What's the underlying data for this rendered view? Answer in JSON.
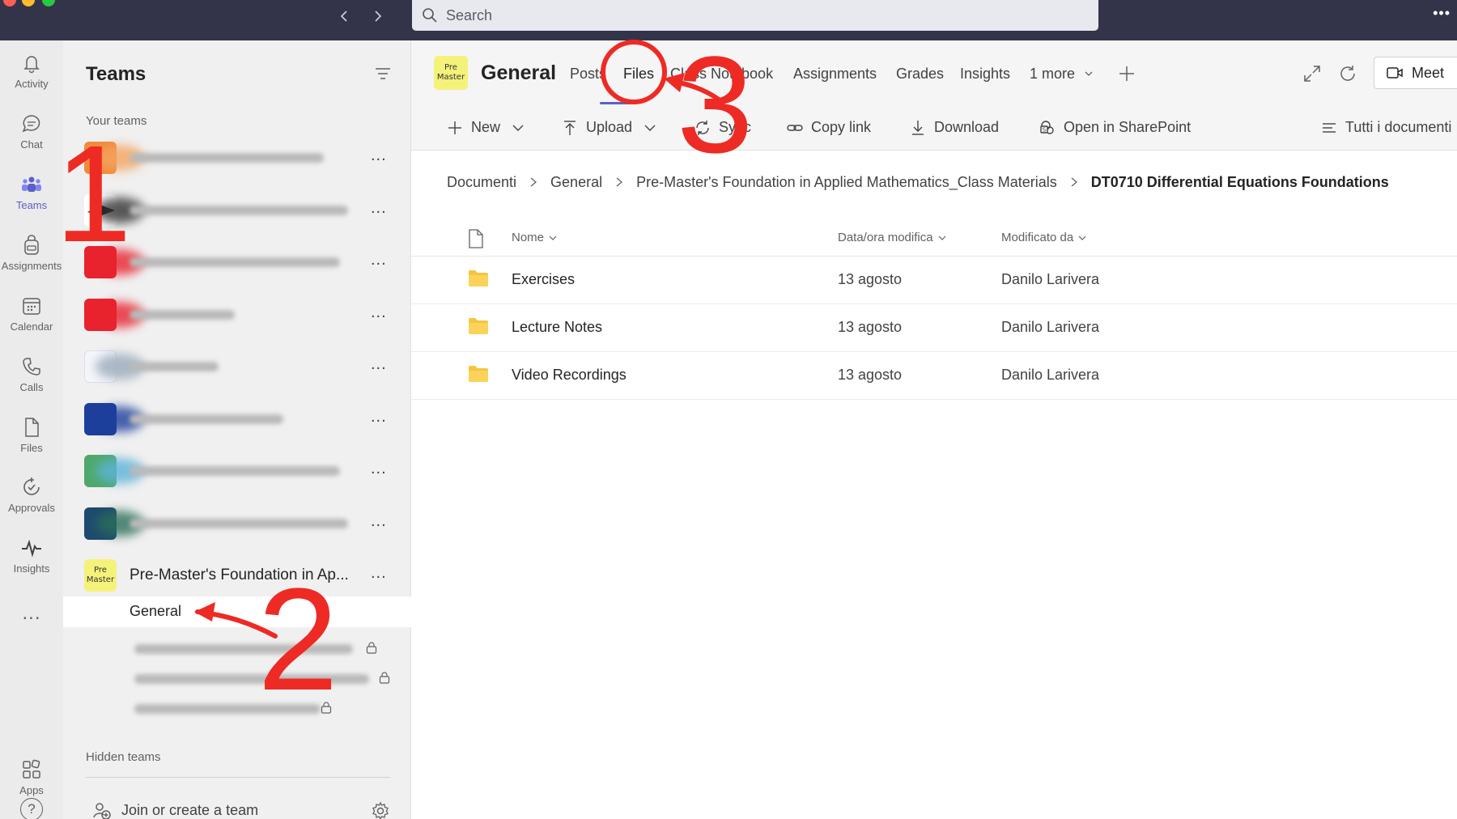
{
  "titlebar": {
    "search_placeholder": "Search",
    "more_icon": "ellipsis-icon",
    "back_icon": "chevron-left-icon",
    "forward_icon": "chevron-right-icon"
  },
  "rail": {
    "items": [
      {
        "label": "Activity",
        "icon": "bell-icon"
      },
      {
        "label": "Chat",
        "icon": "chat-icon"
      },
      {
        "label": "Teams",
        "icon": "teams-icon",
        "active": true
      },
      {
        "label": "Assignments",
        "icon": "backpack-icon"
      },
      {
        "label": "Calendar",
        "icon": "calendar-icon"
      },
      {
        "label": "Calls",
        "icon": "phone-icon"
      },
      {
        "label": "Files",
        "icon": "file-icon"
      },
      {
        "label": "Approvals",
        "icon": "approvals-icon"
      },
      {
        "label": "Insights",
        "icon": "pulse-icon"
      },
      {
        "label": "...",
        "icon": "more-apps-icon"
      },
      {
        "label": "Apps",
        "icon": "apps-icon"
      },
      {
        "label": "?",
        "icon": "help-icon"
      }
    ]
  },
  "panel": {
    "title": "Teams",
    "your_teams_label": "Your teams",
    "teams_more": "...",
    "premaster_team_name": "Pre-Master's Foundation in Ap...",
    "premaster_logo_line1": "Pre",
    "premaster_logo_line2": "Master",
    "selected_channel": "General",
    "hidden_teams_label": "Hidden teams",
    "join_label": "Join or create a team"
  },
  "channel": {
    "logo_line1": "Pre",
    "logo_line2": "Master",
    "title": "General",
    "tabs": [
      "Posts",
      "Files",
      "Class Notebook",
      "Assignments",
      "Grades",
      "Insights",
      "1 more"
    ],
    "active_tab": "Files",
    "meet_label": "Meet"
  },
  "commands": {
    "new": "New",
    "upload": "Upload",
    "sync": "Sync",
    "copy_link": "Copy link",
    "download": "Download",
    "open_sharepoint": "Open in SharePoint",
    "view": "Tutti i documenti"
  },
  "breadcrumb": {
    "items": [
      "Documenti",
      "General",
      "Pre-Master's Foundation in Applied Mathematics_Class Materials"
    ],
    "current": "DT0710 Differential Equations Foundations"
  },
  "list": {
    "col_name": "Nome",
    "col_modified": "Data/ora modifica",
    "col_modified_by": "Modificato da",
    "rows": [
      {
        "name": "Exercises",
        "date": "13 agosto",
        "by": "Danilo Larivera"
      },
      {
        "name": "Lecture Notes",
        "date": "13 agosto",
        "by": "Danilo Larivera"
      },
      {
        "name": "Video Recordings",
        "date": "13 agosto",
        "by": "Danilo Larivera"
      }
    ]
  },
  "annotations": {
    "step1": "1",
    "step2": "2",
    "step3": "3",
    "color": "#ee2a24"
  },
  "colors": {
    "accent": "#5b5fc7",
    "titlebar": "#33344a",
    "folder": "#f4c542"
  }
}
